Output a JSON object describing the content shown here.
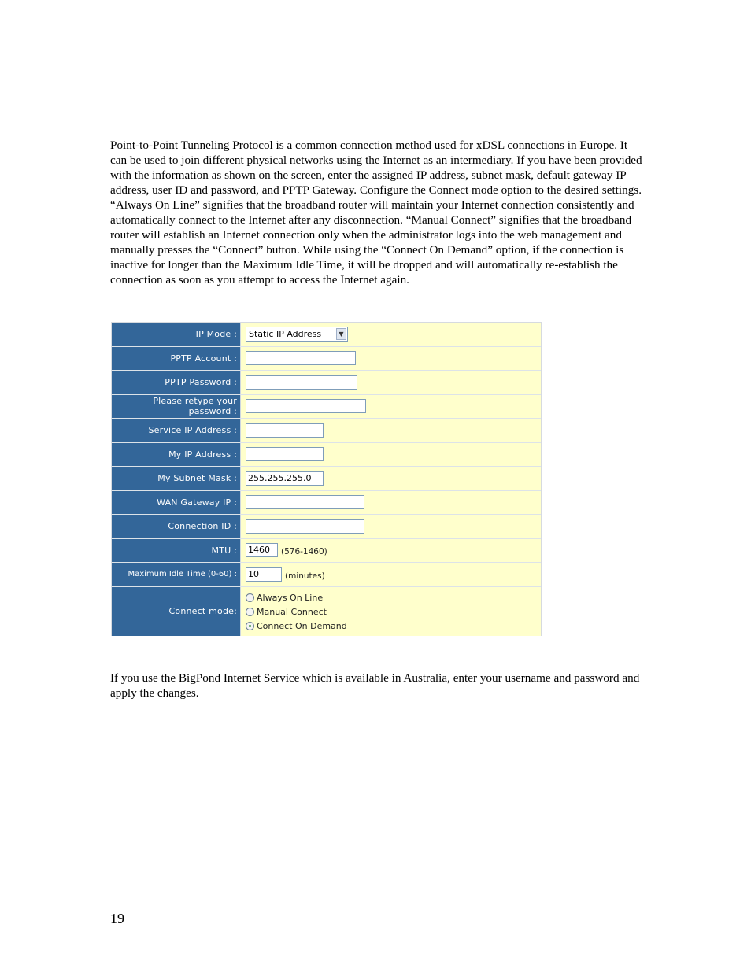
{
  "intro_paragraph": "Point-to-Point Tunneling Protocol is a common connection method used for xDSL connections in Europe. It can be used to join different physical networks using the Internet as an intermediary. If you have been provided with the information as shown on the screen, enter the assigned IP address, subnet mask, default gateway IP address, user ID and password, and PPTP Gateway. Configure the Connect mode option to the desired settings. “Always On Line” signifies that the broadband router will maintain your Internet connection consistently and automatically connect to the Internet after any disconnection. “Manual Connect” signifies that the broadband router will establish an Internet connection only when the administrator logs into the web management and manually presses the “Connect” button. While using the “Connect On Demand” option, if the connection is inactive for longer than the Maximum Idle Time, it will be dropped and will automatically re-establish the connection as soon as you attempt to access the Internet again.",
  "form": {
    "ip_mode": {
      "label": "IP Mode :",
      "selected": "Static IP Address"
    },
    "pptp_account": {
      "label": "PPTP Account :",
      "value": ""
    },
    "pptp_password": {
      "label": "PPTP Password :",
      "value": ""
    },
    "retype_password": {
      "label": "Please retype your password :",
      "value": ""
    },
    "service_ip": {
      "label": "Service IP Address :",
      "value": ""
    },
    "my_ip": {
      "label": "My IP Address :",
      "value": ""
    },
    "subnet_mask": {
      "label": "My Subnet Mask :",
      "value": "255.255.255.0"
    },
    "wan_gateway": {
      "label": "WAN Gateway IP :",
      "value": ""
    },
    "connection_id": {
      "label": "Connection ID :",
      "value": ""
    },
    "mtu": {
      "label": "MTU :",
      "value": "1460",
      "hint": "(576-1460)"
    },
    "idle_time": {
      "label": "Maximum Idle Time (0-60) :",
      "value": "10",
      "hint": "(minutes)"
    },
    "connect_mode": {
      "label": "Connect mode:",
      "options": [
        "Always On Line",
        "Manual Connect",
        "Connect On Demand"
      ],
      "selected": "Connect On Demand"
    }
  },
  "bigpond_paragraph": "If you use the BigPond Internet Service which is available in Australia, enter your username and password and apply the changes.",
  "page_number": "19"
}
